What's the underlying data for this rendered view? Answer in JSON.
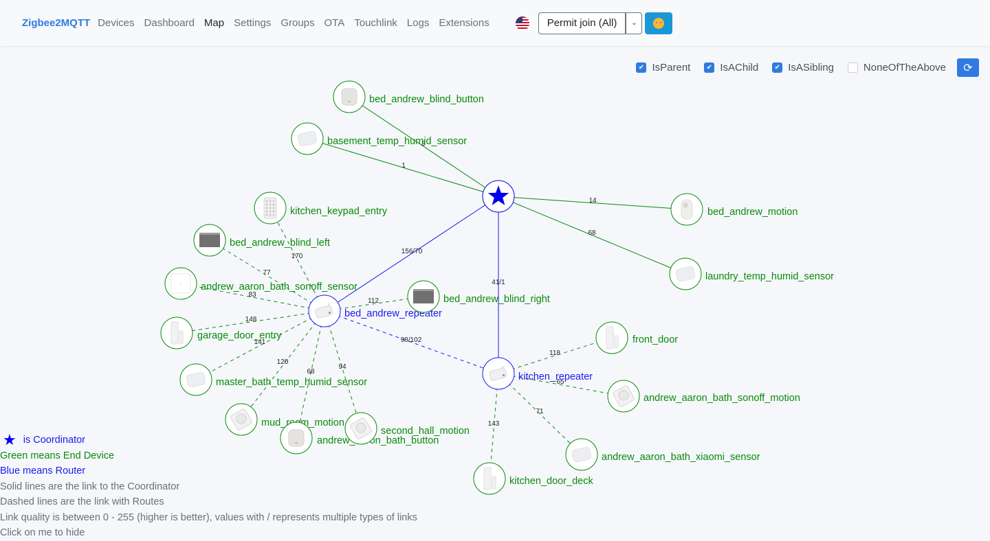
{
  "navbar": {
    "brand": "Zigbee2MQTT",
    "links": [
      {
        "label": "Devices",
        "active": false
      },
      {
        "label": "Dashboard",
        "active": false
      },
      {
        "label": "Map",
        "active": true
      },
      {
        "label": "Settings",
        "active": false
      },
      {
        "label": "Groups",
        "active": false
      },
      {
        "label": "OTA",
        "active": false
      },
      {
        "label": "Touchlink",
        "active": false
      },
      {
        "label": "Logs",
        "active": false
      },
      {
        "label": "Extensions",
        "active": false
      }
    ],
    "language_icon": "us-flag-icon",
    "permit_join_label": "Permit join (All)",
    "permit_join_caret": "⌄",
    "theme_icon": "sun-face-icon"
  },
  "filters": [
    {
      "label": "IsParent",
      "checked": true
    },
    {
      "label": "IsAChild",
      "checked": true
    },
    {
      "label": "IsASibling",
      "checked": true
    },
    {
      "label": "NoneOfTheAbove",
      "checked": false
    }
  ],
  "refresh_icon": "⟳",
  "colors": {
    "end_device": "#0a8a0a",
    "router": "#1a1aee",
    "coordinator": "#0000ee",
    "brand": "#2f7be0"
  },
  "map": {
    "nodes": [
      {
        "id": "coordinator",
        "label": "",
        "type": "Coordinator",
        "icon": "star"
      },
      {
        "id": "bed_andrew_blind_button",
        "label": "bed_andrew_blind_button",
        "type": "EndDevice",
        "icon": "button"
      },
      {
        "id": "basement_temp_humid_sensor",
        "label": "basement_temp_humid_sensor",
        "type": "EndDevice",
        "icon": "sensor"
      },
      {
        "id": "bed_andrew_motion",
        "label": "bed_andrew_motion",
        "type": "EndDevice",
        "icon": "motion-tall"
      },
      {
        "id": "laundry_temp_humid_sensor",
        "label": "laundry_temp_humid_sensor",
        "type": "EndDevice",
        "icon": "sensor"
      },
      {
        "id": "bed_andrew_repeater",
        "label": "bed_andrew_repeater",
        "type": "Router",
        "icon": "plug"
      },
      {
        "id": "kitchen_repeater",
        "label": "kitchen_repeater",
        "type": "Router",
        "icon": "plug"
      },
      {
        "id": "kitchen_keypad_entry",
        "label": "kitchen_keypad_entry",
        "type": "EndDevice",
        "icon": "keypad"
      },
      {
        "id": "bed_andrew_blind_left",
        "label": "bed_andrew_blind_left",
        "type": "EndDevice",
        "icon": "blind"
      },
      {
        "id": "andrew_aaron_bath_sonoff_sensor",
        "label": "andrew_aaron_bath_sonoff_sensor",
        "type": "EndDevice",
        "icon": "square"
      },
      {
        "id": "bed_andrew_blind_right",
        "label": "bed_andrew_blind_right",
        "type": "EndDevice",
        "icon": "blind"
      },
      {
        "id": "garage_door_entry",
        "label": "garage_door_entry",
        "type": "EndDevice",
        "icon": "door"
      },
      {
        "id": "master_bath_temp_humid_sensor",
        "label": "master_bath_temp_humid_sensor",
        "type": "EndDevice",
        "icon": "sensor"
      },
      {
        "id": "mud_room_motion",
        "label": "mud_room_motion",
        "type": "EndDevice",
        "icon": "motion"
      },
      {
        "id": "andrew_aaron_bath_button",
        "label": "andrew_aaron_bath_button",
        "type": "EndDevice",
        "icon": "button"
      },
      {
        "id": "second_hall_motion",
        "label": "second_hall_motion",
        "type": "EndDevice",
        "icon": "motion"
      },
      {
        "id": "front_door",
        "label": "front_door",
        "type": "EndDevice",
        "icon": "door"
      },
      {
        "id": "andrew_aaron_bath_sonoff_motion",
        "label": "andrew_aaron_bath_sonoff_motion",
        "type": "EndDevice",
        "icon": "motion"
      },
      {
        "id": "andrew_aaron_bath_xiaomi_sensor",
        "label": "andrew_aaron_bath_xiaomi_sensor",
        "type": "EndDevice",
        "icon": "sensor"
      },
      {
        "id": "kitchen_door_deck",
        "label": "kitchen_door_deck",
        "type": "EndDevice",
        "icon": "door"
      }
    ],
    "links": [
      {
        "source": "coordinator",
        "target": "bed_andrew_blind_button",
        "lqi": "3",
        "style": "solid",
        "color": "end_device"
      },
      {
        "source": "coordinator",
        "target": "basement_temp_humid_sensor",
        "lqi": "1",
        "style": "solid",
        "color": "end_device"
      },
      {
        "source": "coordinator",
        "target": "bed_andrew_motion",
        "lqi": "14",
        "style": "solid",
        "color": "end_device"
      },
      {
        "source": "coordinator",
        "target": "laundry_temp_humid_sensor",
        "lqi": "68",
        "style": "solid",
        "color": "end_device"
      },
      {
        "source": "coordinator",
        "target": "bed_andrew_repeater",
        "lqi": "156/70",
        "style": "solid",
        "color": "router"
      },
      {
        "source": "coordinator",
        "target": "kitchen_repeater",
        "lqi": "41/1",
        "style": "solid",
        "color": "router"
      },
      {
        "source": "bed_andrew_repeater",
        "target": "kitchen_repeater",
        "lqi": "98/102",
        "style": "dashed",
        "color": "router"
      },
      {
        "source": "bed_andrew_repeater",
        "target": "kitchen_keypad_entry",
        "lqi": "170",
        "style": "dashed",
        "color": "end_device"
      },
      {
        "source": "bed_andrew_repeater",
        "target": "bed_andrew_blind_left",
        "lqi": "77",
        "style": "dashed",
        "color": "end_device"
      },
      {
        "source": "bed_andrew_repeater",
        "target": "andrew_aaron_bath_sonoff_sensor",
        "lqi": "83",
        "style": "dashed",
        "color": "end_device"
      },
      {
        "source": "bed_andrew_repeater",
        "target": "bed_andrew_blind_right",
        "lqi": "112",
        "style": "dashed",
        "color": "end_device"
      },
      {
        "source": "bed_andrew_repeater",
        "target": "garage_door_entry",
        "lqi": "148",
        "style": "dashed",
        "color": "end_device"
      },
      {
        "source": "bed_andrew_repeater",
        "target": "master_bath_temp_humid_sensor",
        "lqi": "141",
        "style": "dashed",
        "color": "end_device"
      },
      {
        "source": "bed_andrew_repeater",
        "target": "mud_room_motion",
        "lqi": "120",
        "style": "dashed",
        "color": "end_device"
      },
      {
        "source": "bed_andrew_repeater",
        "target": "andrew_aaron_bath_button",
        "lqi": "68",
        "style": "dashed",
        "color": "end_device"
      },
      {
        "source": "bed_andrew_repeater",
        "target": "second_hall_motion",
        "lqi": "94",
        "style": "dashed",
        "color": "end_device"
      },
      {
        "source": "kitchen_repeater",
        "target": "front_door",
        "lqi": "118",
        "style": "dashed",
        "color": "end_device"
      },
      {
        "source": "kitchen_repeater",
        "target": "andrew_aaron_bath_sonoff_motion",
        "lqi": "65",
        "style": "dashed",
        "color": "end_device"
      },
      {
        "source": "kitchen_repeater",
        "target": "andrew_aaron_bath_xiaomi_sensor",
        "lqi": "71",
        "style": "dashed",
        "color": "end_device"
      },
      {
        "source": "kitchen_repeater",
        "target": "kitchen_door_deck",
        "lqi": "143",
        "style": "dashed",
        "color": "end_device"
      }
    ]
  },
  "legend": {
    "coordinator": "is Coordinator",
    "end_device": "Green means End Device",
    "router": "Blue means Router",
    "solid": "Solid lines are the link to the Coordinator",
    "dashed": "Dashed lines are the link with Routes",
    "lqi": "Link quality is between 0 - 255 (higher is better), values with / represents multiple types of links",
    "hide": "Click on me to hide"
  }
}
